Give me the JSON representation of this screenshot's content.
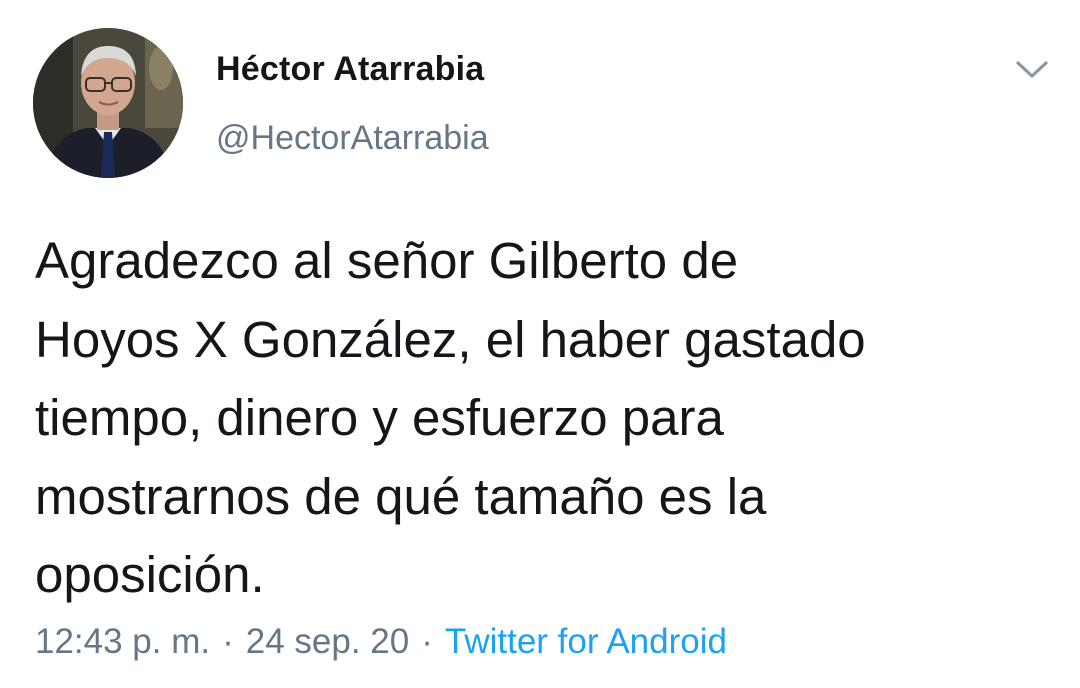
{
  "author": {
    "name": "Héctor Atarrabia",
    "handle": "@HectorAtarrabia"
  },
  "tweet": {
    "text": "Agradezco al señor Gilberto de\nHoyos X González, el haber gastado\ntiempo, dinero y esfuerzo para\nmostrarnos de qué tamaño es la\noposición.",
    "time": "12:43 p. m.",
    "date": "24 sep. 20",
    "separator": "·",
    "source": "Twitter for Android"
  },
  "icons": {
    "menu": "chevron-down-icon",
    "avatar": "profile-photo"
  },
  "colors": {
    "text": "#14171a",
    "secondary": "#657786",
    "link": "#1da1f2",
    "background": "#ffffff"
  }
}
